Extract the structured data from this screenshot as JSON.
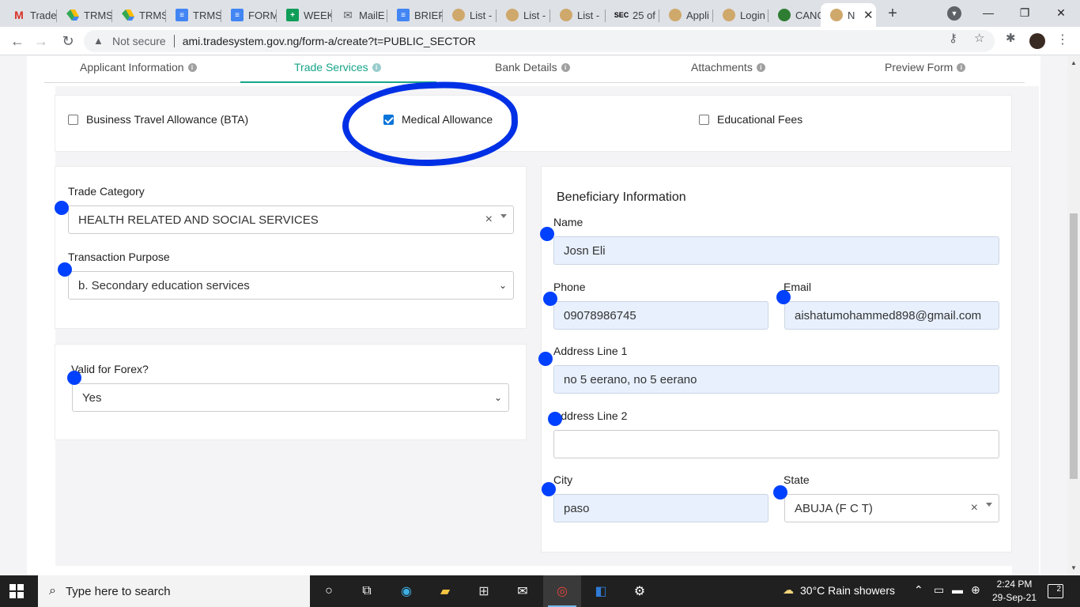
{
  "browser": {
    "tabs": [
      {
        "label": "Trade",
        "icon": "gmail-icon"
      },
      {
        "label": "TRMS",
        "icon": "drive-icon"
      },
      {
        "label": "TRMS",
        "icon": "drive-icon"
      },
      {
        "label": "TRMS",
        "icon": "docs-icon"
      },
      {
        "label": "FORM",
        "icon": "docs-icon"
      },
      {
        "label": "WEEK",
        "icon": "sheets-icon"
      },
      {
        "label": "MailE",
        "icon": "mail-icon"
      },
      {
        "label": "BRIEF",
        "icon": "docs-icon"
      },
      {
        "label": "List -",
        "icon": "person-icon"
      },
      {
        "label": "List -",
        "icon": "person-icon"
      },
      {
        "label": "List -",
        "icon": "person-icon"
      },
      {
        "label": "25 of",
        "icon": "sec-icon"
      },
      {
        "label": "Appli",
        "icon": "person-icon"
      },
      {
        "label": "Login",
        "icon": "person-icon"
      },
      {
        "label": "CANC",
        "icon": "coat-of-arms-icon"
      },
      {
        "label": "N",
        "icon": "person-icon"
      }
    ],
    "security_label": "Not secure",
    "url": "ami.tradesystem.gov.ng/form-a/create?t=PUBLIC_SECTOR"
  },
  "stepper": {
    "steps": [
      {
        "label": "Applicant Information"
      },
      {
        "label": "Trade Services"
      },
      {
        "label": "Bank Details"
      },
      {
        "label": "Attachments"
      },
      {
        "label": "Preview Form"
      }
    ],
    "active_index": 1
  },
  "allowances": {
    "bta": {
      "label": "Business Travel Allowance (BTA)",
      "checked": false
    },
    "medical": {
      "label": "Medical Allowance",
      "checked": true
    },
    "education": {
      "label": "Educational Fees",
      "checked": false
    }
  },
  "trade": {
    "category_label": "Trade Category",
    "category_value": "HEALTH RELATED AND SOCIAL SERVICES",
    "purpose_label": "Transaction Purpose",
    "purpose_value": "b. Secondary education services",
    "forex_label": "Valid for Forex?",
    "forex_value": "Yes"
  },
  "beneficiary": {
    "title": "Beneficiary Information",
    "name_label": "Name",
    "name_value": "Josn Eli",
    "phone_label": "Phone",
    "phone_value": "09078986745",
    "email_label": "Email",
    "email_value": "aishatumohammed898@gmail.com",
    "address1_label": "Address Line 1",
    "address1_value": "no 5 eerano, no 5 eerano",
    "address2_label": "Address Line 2",
    "address2_value": "",
    "city_label": "City",
    "city_value": "paso",
    "state_label": "State",
    "state_value": "ABUJA (F C T)"
  },
  "taskbar": {
    "search_placeholder": "Type here to search",
    "weather": "30°C  Rain showers",
    "time": "2:24 PM",
    "date": "29-Sep-21",
    "notifications": "2"
  },
  "colors": {
    "accent": "#17a589",
    "annotation": "#0030e6",
    "marker": "#0040ff"
  }
}
